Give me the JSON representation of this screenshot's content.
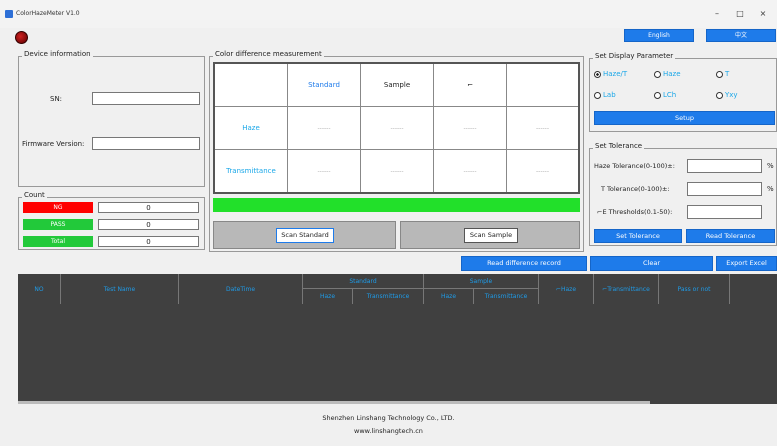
{
  "window": {
    "title": "ColorHazeMeter V1.0",
    "minimize": "–",
    "maximize": "□",
    "close": "×"
  },
  "language": {
    "english": "English",
    "chinese": "中文"
  },
  "device_info": {
    "title": "Device information",
    "sn_label": "SN:",
    "sn_value": "",
    "firmware_label": "Firmware Version:",
    "firmware_value": ""
  },
  "count": {
    "title": "Count",
    "ng_label": "NG",
    "ng_value": "0",
    "pass_label": "PASS",
    "pass_value": "0",
    "total_label": "Total",
    "total_value": "0",
    "colors": {
      "ng": "#ff0000",
      "pass": "#22c93a",
      "total": "#22c93a"
    }
  },
  "color_diff": {
    "title": "Color difference measurement",
    "col_standard": "Standard",
    "col_sample": "Sample",
    "col_delta": "⌐",
    "col_extra": "",
    "row_haze": "Haze",
    "row_trans": "Transmittance",
    "haze_values": [
      "------",
      "------",
      "------",
      "------"
    ],
    "trans_values": [
      "------",
      "------",
      "------",
      "------"
    ],
    "result_bar_color": "#22e02a",
    "scan_standard": "Scan Standard",
    "scan_sample": "Scan Sample"
  },
  "display_param": {
    "title": "Set Display Parameter",
    "options": [
      "Haze/T",
      "Haze",
      "T",
      "Lab",
      "LCh",
      "Yxy"
    ],
    "selected": "Haze/T",
    "setup": "Setup"
  },
  "tolerance": {
    "title": "Set Tolerance",
    "haze_label": "Haze Tolerance(0-100)±:",
    "t_label": "T Tolerance(0-100)±:",
    "e_label": "⌐E Thresholds(0.1-50):",
    "unit": "%",
    "set_button": "Set Tolerance",
    "read_button": "Read Tolerance"
  },
  "actions": {
    "read_diff": "Read difference record",
    "clear": "Clear",
    "export": "Export Excel"
  },
  "grid": {
    "no": "NO",
    "test_name": "Test Name",
    "datetime": "DateTime",
    "standard": "Standard",
    "sample": "Sample",
    "haze": "Haze",
    "transmittance": "Transmittance",
    "d_haze": "⌐Haze",
    "d_trans": "⌐Transmittance",
    "pass": "Pass or not"
  },
  "footer": {
    "company": "Shenzhen Linshang Technology Co., LTD.",
    "website": "www.linshangtech.cn"
  }
}
